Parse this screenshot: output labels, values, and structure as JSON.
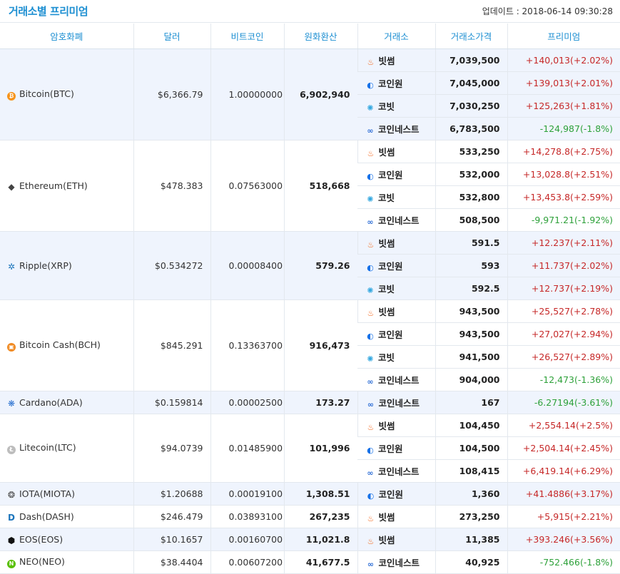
{
  "header": {
    "title": "거래소별 프리미엄",
    "update_label": "업데이트 : 2018-06-14 09:30:28"
  },
  "columns": [
    "암호화폐",
    "달러",
    "비트코인",
    "원화환산",
    "거래소",
    "거래소가격",
    "프리미엄"
  ],
  "coins": [
    {
      "name": "Bitcoin(BTC)",
      "icon": "bitcoin-icon",
      "usd": "$6,366.79",
      "btc": "1.00000000",
      "krw": "6,902,940",
      "exchanges": [
        {
          "exchange": "빗썸",
          "icon": "bithumb-icon",
          "price": "7,039,500",
          "premium": "+140,013(+2.02%)"
        },
        {
          "exchange": "코인원",
          "icon": "coinone-icon",
          "price": "7,045,000",
          "premium": "+139,013(+2.01%)"
        },
        {
          "exchange": "코빗",
          "icon": "korbit-icon",
          "price": "7,030,250",
          "premium": "+125,263(+1.81%)"
        },
        {
          "exchange": "코인네스트",
          "icon": "coinnest-icon",
          "price": "6,783,500",
          "premium": "-124,987(-1.8%)"
        }
      ]
    },
    {
      "name": "Ethereum(ETH)",
      "icon": "ethereum-icon",
      "usd": "$478.383",
      "btc": "0.07563000",
      "krw": "518,668",
      "exchanges": [
        {
          "exchange": "빗썸",
          "icon": "bithumb-icon",
          "price": "533,250",
          "premium": "+14,278.8(+2.75%)"
        },
        {
          "exchange": "코인원",
          "icon": "coinone-icon",
          "price": "532,000",
          "premium": "+13,028.8(+2.51%)"
        },
        {
          "exchange": "코빗",
          "icon": "korbit-icon",
          "price": "532,800",
          "premium": "+13,453.8(+2.59%)"
        },
        {
          "exchange": "코인네스트",
          "icon": "coinnest-icon",
          "price": "508,500",
          "premium": "-9,971.21(-1.92%)"
        }
      ]
    },
    {
      "name": "Ripple(XRP)",
      "icon": "ripple-icon",
      "usd": "$0.534272",
      "btc": "0.00008400",
      "krw": "579.26",
      "exchanges": [
        {
          "exchange": "빗썸",
          "icon": "bithumb-icon",
          "price": "591.5",
          "premium": "+12.237(+2.11%)"
        },
        {
          "exchange": "코인원",
          "icon": "coinone-icon",
          "price": "593",
          "premium": "+11.737(+2.02%)"
        },
        {
          "exchange": "코빗",
          "icon": "korbit-icon",
          "price": "592.5",
          "premium": "+12.737(+2.19%)"
        }
      ]
    },
    {
      "name": "Bitcoin Cash(BCH)",
      "icon": "bitcoin-cash-icon",
      "usd": "$845.291",
      "btc": "0.13363700",
      "krw": "916,473",
      "exchanges": [
        {
          "exchange": "빗썸",
          "icon": "bithumb-icon",
          "price": "943,500",
          "premium": "+25,527(+2.78%)"
        },
        {
          "exchange": "코인원",
          "icon": "coinone-icon",
          "price": "943,500",
          "premium": "+27,027(+2.94%)"
        },
        {
          "exchange": "코빗",
          "icon": "korbit-icon",
          "price": "941,500",
          "premium": "+26,527(+2.89%)"
        },
        {
          "exchange": "코인네스트",
          "icon": "coinnest-icon",
          "price": "904,000",
          "premium": "-12,473(-1.36%)"
        }
      ]
    },
    {
      "name": "Cardano(ADA)",
      "icon": "cardano-icon",
      "usd": "$0.159814",
      "btc": "0.00002500",
      "krw": "173.27",
      "exchanges": [
        {
          "exchange": "코인네스트",
          "icon": "coinnest-icon",
          "price": "167",
          "premium": "-6.27194(-3.61%)"
        }
      ]
    },
    {
      "name": "Litecoin(LTC)",
      "icon": "litecoin-icon",
      "usd": "$94.0739",
      "btc": "0.01485900",
      "krw": "101,996",
      "exchanges": [
        {
          "exchange": "빗썸",
          "icon": "bithumb-icon",
          "price": "104,450",
          "premium": "+2,554.14(+2.5%)"
        },
        {
          "exchange": "코인원",
          "icon": "coinone-icon",
          "price": "104,500",
          "premium": "+2,504.14(+2.45%)"
        },
        {
          "exchange": "코인네스트",
          "icon": "coinnest-icon",
          "price": "108,415",
          "premium": "+6,419.14(+6.29%)"
        }
      ]
    },
    {
      "name": "IOTA(MIOTA)",
      "icon": "iota-icon",
      "usd": "$1.20688",
      "btc": "0.00019100",
      "krw": "1,308.51",
      "exchanges": [
        {
          "exchange": "코인원",
          "icon": "coinone-icon",
          "price": "1,360",
          "premium": "+41.4886(+3.17%)"
        }
      ]
    },
    {
      "name": "Dash(DASH)",
      "icon": "dash-icon",
      "usd": "$246.479",
      "btc": "0.03893100",
      "krw": "267,235",
      "exchanges": [
        {
          "exchange": "빗썸",
          "icon": "bithumb-icon",
          "price": "273,250",
          "premium": "+5,915(+2.21%)"
        }
      ]
    },
    {
      "name": "EOS(EOS)",
      "icon": "eos-icon",
      "usd": "$10.1657",
      "btc": "0.00160700",
      "krw": "11,021.8",
      "exchanges": [
        {
          "exchange": "빗썸",
          "icon": "bithumb-icon",
          "price": "11,385",
          "premium": "+393.246(+3.56%)"
        }
      ]
    },
    {
      "name": "NEO(NEO)",
      "icon": "neo-icon",
      "usd": "$38.4404",
      "btc": "0.00607200",
      "krw": "41,677.5",
      "exchanges": [
        {
          "exchange": "코인네스트",
          "icon": "coinnest-icon",
          "price": "40,925",
          "premium": "-752.466(-1.8%)"
        }
      ]
    }
  ],
  "colors": {
    "header_text": "#1d8fd2",
    "shade_row": "#eff4fd",
    "positive": "#c62828",
    "negative": "#2ea13a"
  }
}
